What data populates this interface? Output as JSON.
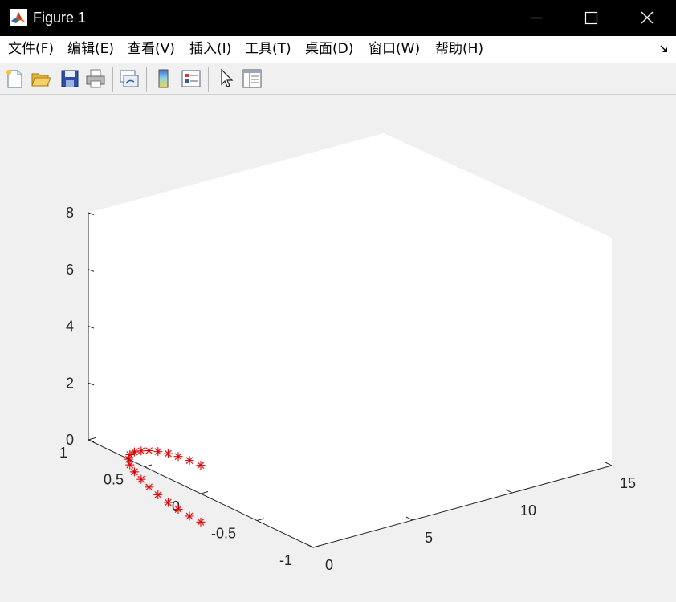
{
  "window": {
    "title": "Figure 1"
  },
  "menu": {
    "items": [
      "文件(F)",
      "编辑(E)",
      "查看(V)",
      "插入(I)",
      "工具(T)",
      "桌面(D)",
      "窗口(W)",
      "帮助(H)"
    ]
  },
  "toolbar": {
    "tools": [
      "new-figure-icon",
      "open-file-icon",
      "save-icon",
      "print-icon",
      "link-plot-icon",
      "colorbar-icon",
      "legend-icon",
      "edit-plot-arrow-icon",
      "property-inspector-icon"
    ]
  },
  "colors": {
    "titlebar": "#000000",
    "figure_bg": "#f0f0f0",
    "axes_bg": "#ffffff",
    "marker": "#e00000"
  },
  "chart_data": {
    "type": "scatter",
    "view": "3d",
    "marker": "*",
    "marker_color": "#e00000",
    "xlim": [
      0,
      15
    ],
    "ylim": [
      -1,
      1
    ],
    "zlim": [
      0,
      8
    ],
    "x_ticks": [
      "0",
      "5",
      "10",
      "15"
    ],
    "y_ticks": [
      "-1",
      "-0.5",
      "0",
      "0.5",
      "1"
    ],
    "z_ticks": [
      "0",
      "2",
      "4",
      "6",
      "8"
    ],
    "points": [
      {
        "x": 0,
        "y": 0.0,
        "z": 1.0
      },
      {
        "x": 0,
        "y": 0.1,
        "z": 0.98
      },
      {
        "x": 0,
        "y": 0.2,
        "z": 0.93
      },
      {
        "x": 0,
        "y": 0.29,
        "z": 0.86
      },
      {
        "x": 0,
        "y": 0.38,
        "z": 0.76
      },
      {
        "x": 0,
        "y": 0.46,
        "z": 0.64
      },
      {
        "x": 0,
        "y": 0.53,
        "z": 0.5
      },
      {
        "x": 0,
        "y": 0.59,
        "z": 0.35
      },
      {
        "x": 0,
        "y": 0.63,
        "z": 0.18
      },
      {
        "x": 0,
        "y": 0.64,
        "z": 0.0
      },
      {
        "x": 0,
        "y": 0.63,
        "z": -0.18
      },
      {
        "x": 0,
        "y": 0.59,
        "z": -0.35
      },
      {
        "x": 0,
        "y": 0.53,
        "z": -0.5
      },
      {
        "x": 0,
        "y": 0.46,
        "z": -0.64
      },
      {
        "x": 0,
        "y": 0.38,
        "z": -0.76
      },
      {
        "x": 0,
        "y": 0.29,
        "z": -0.86
      },
      {
        "x": 0,
        "y": 0.2,
        "z": -0.93
      },
      {
        "x": 0,
        "y": 0.1,
        "z": -0.98
      },
      {
        "x": 0,
        "y": 0.0,
        "z": -1.0
      }
    ]
  }
}
